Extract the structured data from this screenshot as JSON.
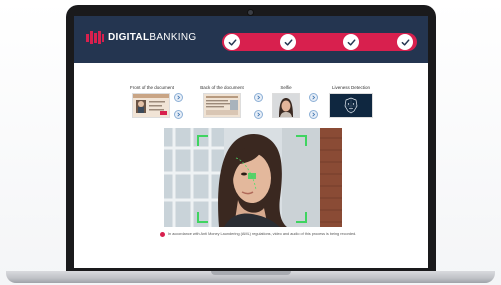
{
  "app": {
    "logo_bold": "DIGITAL",
    "logo_light": "BANKING"
  },
  "progress": {
    "steps_completed": 4,
    "steps_total": 4
  },
  "steps": [
    {
      "label": "Front of the document"
    },
    {
      "label": "Back of the document"
    },
    {
      "label": "Selfie"
    },
    {
      "label": "Liveness Detection"
    }
  ],
  "notice": {
    "text": "In accordance with Anti Money Laundering (AML) regulations, video and audio of this process is being recorded."
  },
  "colors": {
    "header_bg": "#243550",
    "accent": "#d8204e",
    "arrow": "#8db0d6"
  }
}
